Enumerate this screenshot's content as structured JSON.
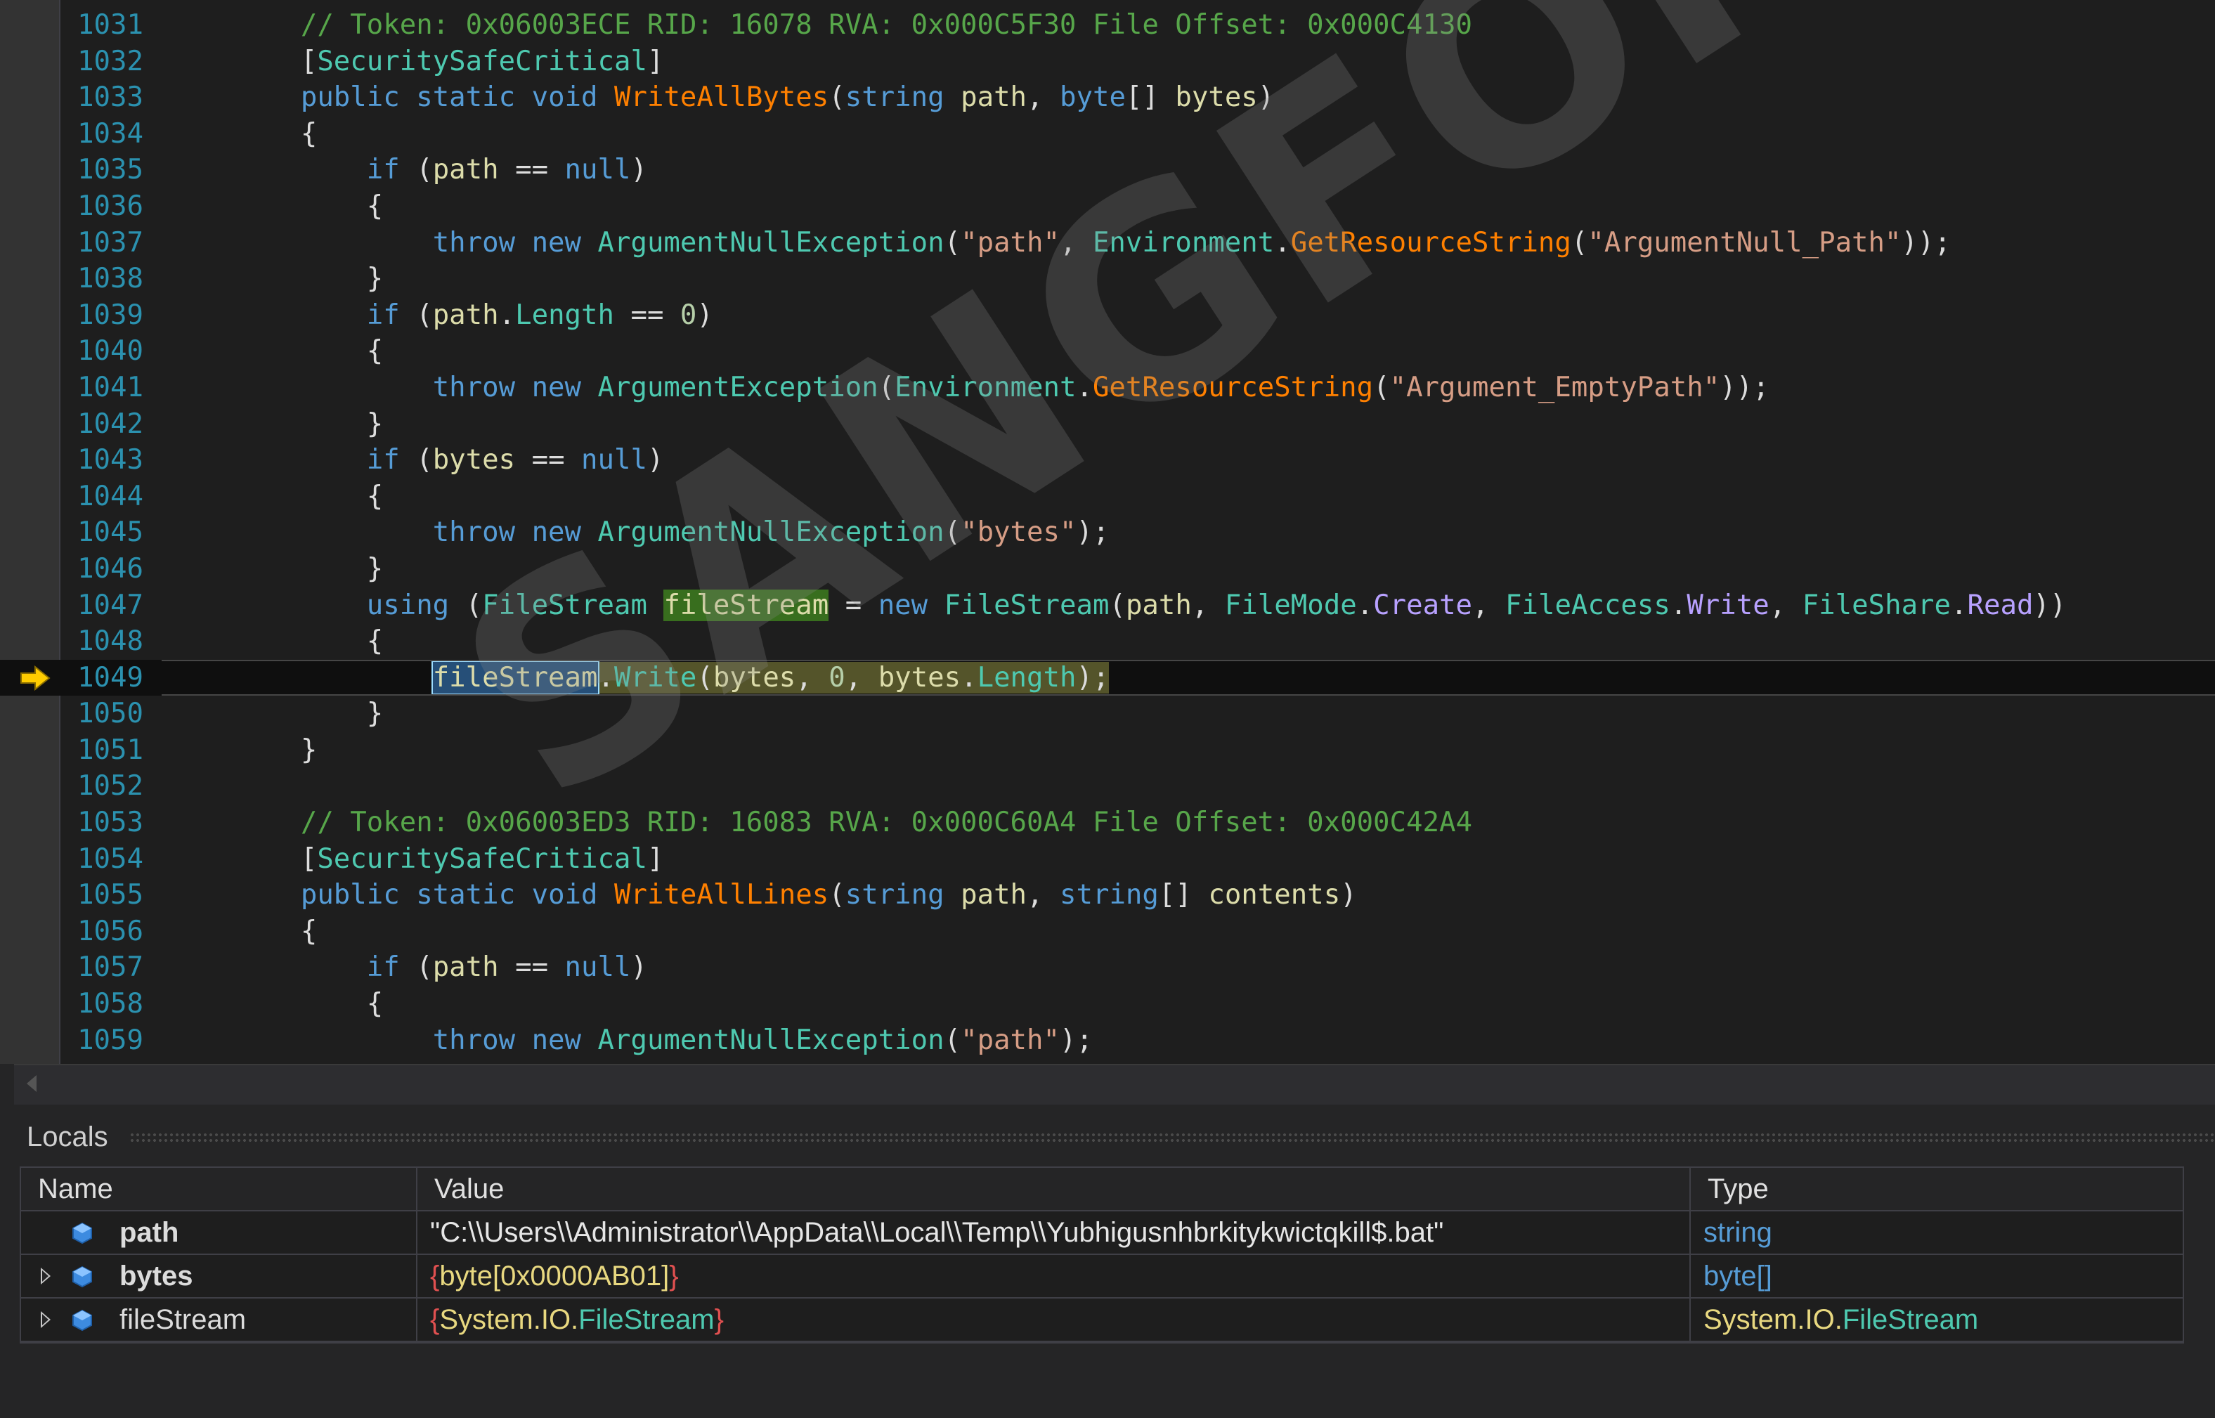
{
  "editor": {
    "current_line": "1049",
    "lines": [
      {
        "n": "1031",
        "t": [
          [
            "        ",
            "pl"
          ],
          [
            "// Token: 0x06003ECE RID: 16078 RVA: 0x000C5F30 File Offset: 0x000C4130",
            "cm"
          ]
        ]
      },
      {
        "n": "1032",
        "t": [
          [
            "        [",
            "pl"
          ],
          [
            "SecuritySafeCritical",
            "ty"
          ],
          [
            "]",
            "pl"
          ]
        ]
      },
      {
        "n": "1033",
        "t": [
          [
            "        ",
            "pl"
          ],
          [
            "public",
            "kw"
          ],
          [
            " ",
            "pl"
          ],
          [
            "static",
            "kw"
          ],
          [
            " ",
            "pl"
          ],
          [
            "void",
            "kw"
          ],
          [
            " ",
            "pl"
          ],
          [
            "WriteAllBytes",
            "me"
          ],
          [
            "(",
            "pl"
          ],
          [
            "string",
            "kw"
          ],
          [
            " ",
            "pl"
          ],
          [
            "path",
            "vr"
          ],
          [
            ", ",
            "pl"
          ],
          [
            "byte",
            "kw"
          ],
          [
            "[] ",
            "pl"
          ],
          [
            "bytes",
            "vr"
          ],
          [
            ")",
            "pl"
          ]
        ]
      },
      {
        "n": "1034",
        "t": [
          [
            "        {",
            "pl"
          ]
        ]
      },
      {
        "n": "1035",
        "t": [
          [
            "            ",
            "pl"
          ],
          [
            "if",
            "kw"
          ],
          [
            " (",
            "pl"
          ],
          [
            "path",
            "vr"
          ],
          [
            " == ",
            "pl"
          ],
          [
            "null",
            "kw"
          ],
          [
            ")",
            "pl"
          ]
        ]
      },
      {
        "n": "1036",
        "t": [
          [
            "            {",
            "pl"
          ]
        ]
      },
      {
        "n": "1037",
        "t": [
          [
            "                ",
            "pl"
          ],
          [
            "throw",
            "kw"
          ],
          [
            " ",
            "pl"
          ],
          [
            "new",
            "kw"
          ],
          [
            " ",
            "pl"
          ],
          [
            "ArgumentNullException",
            "ty"
          ],
          [
            "(",
            "pl"
          ],
          [
            "\"path\"",
            "st"
          ],
          [
            ", ",
            "pl"
          ],
          [
            "Environment",
            "ty"
          ],
          [
            ".",
            "pl"
          ],
          [
            "GetResourceString",
            "me"
          ],
          [
            "(",
            "pl"
          ],
          [
            "\"ArgumentNull_Path\"",
            "st"
          ],
          [
            "));",
            "pl"
          ]
        ]
      },
      {
        "n": "1038",
        "t": [
          [
            "            }",
            "pl"
          ]
        ]
      },
      {
        "n": "1039",
        "t": [
          [
            "            ",
            "pl"
          ],
          [
            "if",
            "kw"
          ],
          [
            " (",
            "pl"
          ],
          [
            "path",
            "vr"
          ],
          [
            ".",
            "pl"
          ],
          [
            "Length",
            "ty"
          ],
          [
            " == ",
            "pl"
          ],
          [
            "0",
            "nu"
          ],
          [
            ")",
            "pl"
          ]
        ]
      },
      {
        "n": "1040",
        "t": [
          [
            "            {",
            "pl"
          ]
        ]
      },
      {
        "n": "1041",
        "t": [
          [
            "                ",
            "pl"
          ],
          [
            "throw",
            "kw"
          ],
          [
            " ",
            "pl"
          ],
          [
            "new",
            "kw"
          ],
          [
            " ",
            "pl"
          ],
          [
            "ArgumentException",
            "ty"
          ],
          [
            "(",
            "pl"
          ],
          [
            "Environment",
            "ty"
          ],
          [
            ".",
            "pl"
          ],
          [
            "GetResourceString",
            "me"
          ],
          [
            "(",
            "pl"
          ],
          [
            "\"Argument_EmptyPath\"",
            "st"
          ],
          [
            "));",
            "pl"
          ]
        ]
      },
      {
        "n": "1042",
        "t": [
          [
            "            }",
            "pl"
          ]
        ]
      },
      {
        "n": "1043",
        "t": [
          [
            "            ",
            "pl"
          ],
          [
            "if",
            "kw"
          ],
          [
            " (",
            "pl"
          ],
          [
            "bytes",
            "vr"
          ],
          [
            " == ",
            "pl"
          ],
          [
            "null",
            "kw"
          ],
          [
            ")",
            "pl"
          ]
        ]
      },
      {
        "n": "1044",
        "t": [
          [
            "            {",
            "pl"
          ]
        ]
      },
      {
        "n": "1045",
        "t": [
          [
            "                ",
            "pl"
          ],
          [
            "throw",
            "kw"
          ],
          [
            " ",
            "pl"
          ],
          [
            "new",
            "kw"
          ],
          [
            " ",
            "pl"
          ],
          [
            "ArgumentNullException",
            "ty"
          ],
          [
            "(",
            "pl"
          ],
          [
            "\"bytes\"",
            "st"
          ],
          [
            ");",
            "pl"
          ]
        ]
      },
      {
        "n": "1046",
        "t": [
          [
            "            }",
            "pl"
          ]
        ]
      },
      {
        "n": "1047",
        "t": [
          [
            "            ",
            "pl"
          ],
          [
            "using",
            "kw"
          ],
          [
            " (",
            "pl"
          ],
          [
            "FileStream",
            "ty"
          ],
          [
            " ",
            "pl"
          ],
          [
            "fileStream",
            "hr"
          ],
          [
            " = ",
            "pl"
          ],
          [
            "new",
            "kw"
          ],
          [
            " ",
            "pl"
          ],
          [
            "FileStream",
            "ty"
          ],
          [
            "(",
            "pl"
          ],
          [
            "path",
            "vr"
          ],
          [
            ", ",
            "pl"
          ],
          [
            "FileMode",
            "ty"
          ],
          [
            ".",
            "pl"
          ],
          [
            "Create",
            "en"
          ],
          [
            ", ",
            "pl"
          ],
          [
            "FileAccess",
            "ty"
          ],
          [
            ".",
            "pl"
          ],
          [
            "Write",
            "en"
          ],
          [
            ", ",
            "pl"
          ],
          [
            "FileShare",
            "ty"
          ],
          [
            ".",
            "pl"
          ],
          [
            "Read",
            "en"
          ],
          [
            "))",
            "pl"
          ]
        ]
      },
      {
        "n": "1048",
        "t": [
          [
            "            {",
            "pl"
          ]
        ]
      },
      {
        "n": "1049",
        "t": [
          [
            "                ",
            "pl"
          ],
          [
            "fileStream",
            "hs"
          ],
          [
            ".",
            "hx"
          ],
          [
            "Write",
            "hy"
          ],
          [
            "(",
            "hx"
          ],
          [
            "bytes",
            "hv"
          ],
          [
            ", ",
            "hx"
          ],
          [
            "0",
            "hn"
          ],
          [
            ", ",
            "hx"
          ],
          [
            "bytes",
            "hv"
          ],
          [
            ".",
            "hx"
          ],
          [
            "Length",
            "hy"
          ],
          [
            ");",
            "hx"
          ]
        ]
      },
      {
        "n": "1050",
        "t": [
          [
            "            }",
            "pl"
          ]
        ]
      },
      {
        "n": "1051",
        "t": [
          [
            "        }",
            "pl"
          ]
        ]
      },
      {
        "n": "1052",
        "t": [
          [
            "",
            "pl"
          ]
        ]
      },
      {
        "n": "1053",
        "t": [
          [
            "        ",
            "pl"
          ],
          [
            "// Token: 0x06003ED3 RID: 16083 RVA: 0x000C60A4 File Offset: 0x000C42A4",
            "cm"
          ]
        ]
      },
      {
        "n": "1054",
        "t": [
          [
            "        [",
            "pl"
          ],
          [
            "SecuritySafeCritical",
            "ty"
          ],
          [
            "]",
            "pl"
          ]
        ]
      },
      {
        "n": "1055",
        "t": [
          [
            "        ",
            "pl"
          ],
          [
            "public",
            "kw"
          ],
          [
            " ",
            "pl"
          ],
          [
            "static",
            "kw"
          ],
          [
            " ",
            "pl"
          ],
          [
            "void",
            "kw"
          ],
          [
            " ",
            "pl"
          ],
          [
            "WriteAllLines",
            "me"
          ],
          [
            "(",
            "pl"
          ],
          [
            "string",
            "kw"
          ],
          [
            " ",
            "pl"
          ],
          [
            "path",
            "vr"
          ],
          [
            ", ",
            "pl"
          ],
          [
            "string",
            "kw"
          ],
          [
            "[] ",
            "pl"
          ],
          [
            "contents",
            "vr"
          ],
          [
            ")",
            "pl"
          ]
        ]
      },
      {
        "n": "1056",
        "t": [
          [
            "        {",
            "pl"
          ]
        ]
      },
      {
        "n": "1057",
        "t": [
          [
            "            ",
            "pl"
          ],
          [
            "if",
            "kw"
          ],
          [
            " (",
            "pl"
          ],
          [
            "path",
            "vr"
          ],
          [
            " == ",
            "pl"
          ],
          [
            "null",
            "kw"
          ],
          [
            ")",
            "pl"
          ]
        ]
      },
      {
        "n": "1058",
        "t": [
          [
            "            {",
            "pl"
          ]
        ]
      },
      {
        "n": "1059",
        "t": [
          [
            "                ",
            "pl"
          ],
          [
            "throw",
            "kw"
          ],
          [
            " ",
            "pl"
          ],
          [
            "new",
            "kw"
          ],
          [
            " ",
            "pl"
          ],
          [
            "ArgumentNullException",
            "ty"
          ],
          [
            "(",
            "pl"
          ],
          [
            "\"path\"",
            "st"
          ],
          [
            ");",
            "pl"
          ]
        ]
      }
    ]
  },
  "watermark": "SANGFOR",
  "locals": {
    "title": "Locals",
    "columns": {
      "name": "Name",
      "value": "Value",
      "type": "Type"
    },
    "rows": [
      {
        "name": "path",
        "expandable": false,
        "bold": true,
        "value_open": "",
        "value_a": "\"C:\\\\Users\\\\Administrator\\\\AppData\\\\Local\\\\Temp\\\\Yubhigusnhbrkitykwictqkill$.bat\"",
        "value_b": "",
        "value_close": "",
        "type_a": "string",
        "type_b": ""
      },
      {
        "name": "bytes",
        "expandable": true,
        "bold": true,
        "value_open": "{",
        "value_a": "byte",
        "value_b": "[0x0000AB01]",
        "value_close": "}",
        "type_a": "byte[]",
        "type_b": ""
      },
      {
        "name": "fileStream",
        "expandable": true,
        "bold": false,
        "value_open": "{",
        "value_a": "System.IO.",
        "value_b": "FileStream",
        "value_close": "}",
        "type_a": "System.IO.",
        "type_b": "FileStream"
      }
    ]
  },
  "colors": {
    "editor_bg": "#1e1e1e",
    "line_number": "#2b91af",
    "keyword": "#569cd6",
    "type": "#4ec9b0",
    "method": "#ff8000",
    "string": "#d69d85",
    "comment": "#57a64a",
    "reference_highlight": "#386e1e",
    "current_statement": "#54542a",
    "breakpoint_arrow": "#ffcc00"
  },
  "icons": {
    "execution_pointer": "current-statement-arrow-icon",
    "local_variable": "local-variable-icon",
    "expand": "expand-triangle-icon",
    "scroll_left": "scroll-left-arrow-icon"
  }
}
